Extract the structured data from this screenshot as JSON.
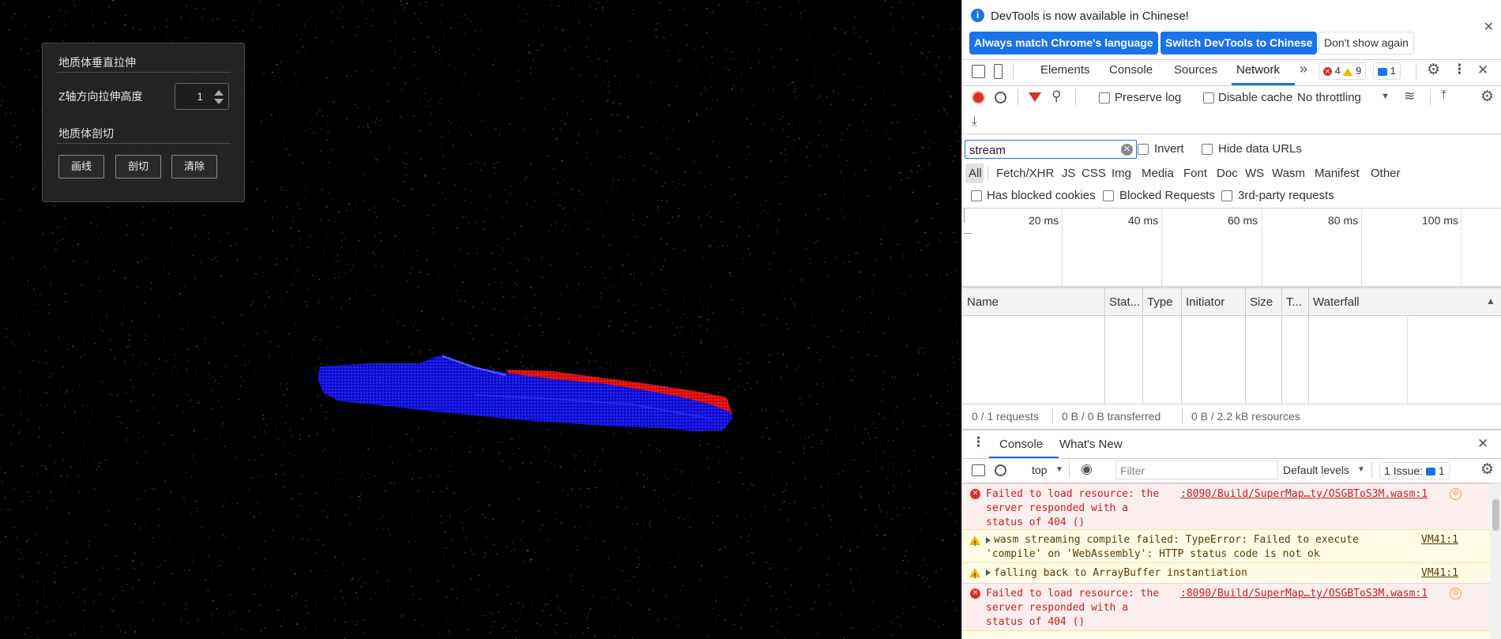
{
  "panel": {
    "title_extrude": "地质体垂直拉伸",
    "z_label": "Z轴方向拉伸高度",
    "z_value": "1",
    "title_cut": "地质体剖切",
    "btn_draw": "画线",
    "btn_cut": "剖切",
    "btn_clear": "清除"
  },
  "devtools": {
    "infobar": {
      "message": "DevTools is now available in Chinese!",
      "btn_match": "Always match Chrome's language",
      "btn_switch": "Switch DevTools to Chinese",
      "btn_dismiss": "Don't show again"
    },
    "tabs": [
      "Elements",
      "Console",
      "Sources",
      "Network"
    ],
    "active_tab": "Network",
    "more_tabs": "»",
    "errors_count": "4",
    "warnings_count": "9",
    "messages_count": "1",
    "network_toolbar": {
      "preserve_log": "Preserve log",
      "disable_cache": "Disable cache",
      "throttling": "No throttling"
    },
    "filter": {
      "value": "stream",
      "invert": "Invert",
      "hide_data_urls": "Hide data URLs"
    },
    "type_filters": [
      "All",
      "Fetch/XHR",
      "JS",
      "CSS",
      "Img",
      "Media",
      "Font",
      "Doc",
      "WS",
      "Wasm",
      "Manifest",
      "Other"
    ],
    "options": {
      "blocked_cookies": "Has blocked cookies",
      "blocked_requests": "Blocked Requests",
      "third_party": "3rd-party requests"
    },
    "timeline_ticks": [
      "20 ms",
      "40 ms",
      "60 ms",
      "80 ms",
      "100 ms"
    ],
    "columns": [
      "Name",
      "Stat...",
      "Type",
      "Initiator",
      "Size",
      "T...",
      "Waterfall"
    ],
    "status": {
      "requests": "0 / 1 requests",
      "transferred": "0 B / 0 B transferred",
      "resources": "0 B / 2.2 kB resources"
    },
    "drawer": {
      "tabs": [
        "Console",
        "What's New"
      ],
      "context": "top",
      "filter_placeholder": "Filter",
      "levels": "Default levels",
      "issues_label": "1 Issue:",
      "issues_count": "1"
    },
    "console_messages": [
      {
        "level": "error",
        "lines": [
          "Failed to load resource: the",
          "server responded with a",
          "status of 404 ()"
        ],
        "source": ":8090/Build/SuperMap…ty/OSGBToS3M.wasm:1"
      },
      {
        "level": "warning",
        "lines": [
          "wasm streaming compile failed: TypeError: Failed to execute",
          "'compile' on 'WebAssembly': HTTP status code is not ok"
        ],
        "source": "VM41:1"
      },
      {
        "level": "warning",
        "lines": [
          "falling back to ArrayBuffer instantiation"
        ],
        "source": "VM41:1"
      },
      {
        "level": "error",
        "lines": [
          "Failed to load resource: the",
          "server responded with a",
          "status of 404 ()"
        ],
        "source": ":8090/Build/SuperMap…ty/OSGBToS3M.wasm:1"
      }
    ]
  },
  "colors": {
    "scene_bg": "#000000",
    "model_blue": "#1a1aff",
    "model_red": "#ff1a1a",
    "accent": "#1a73e8",
    "error": "#d93025",
    "warning": "#f2b600"
  }
}
